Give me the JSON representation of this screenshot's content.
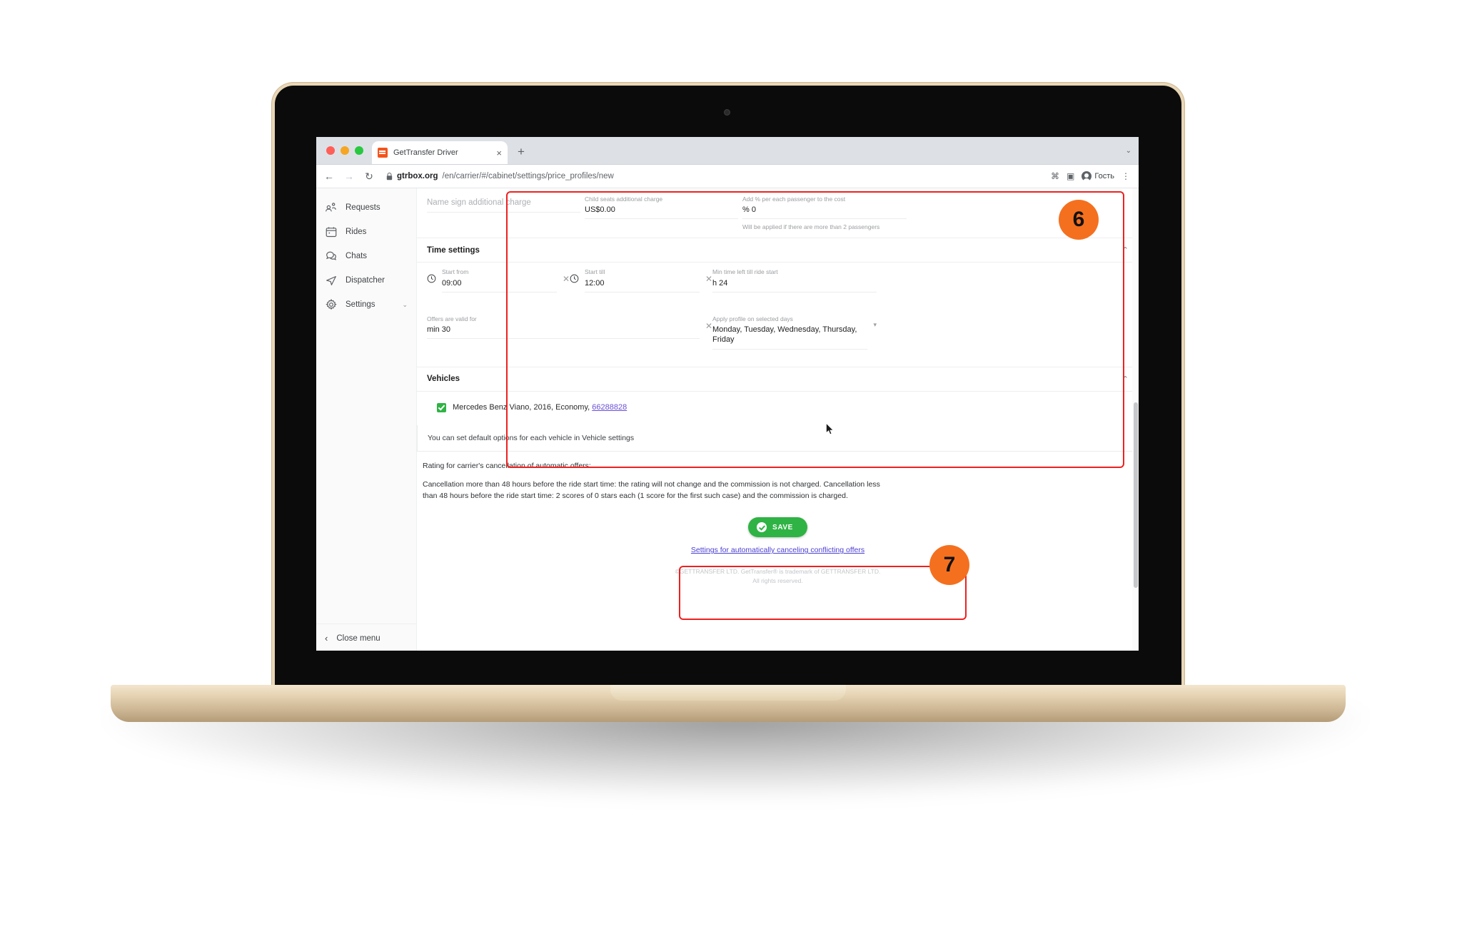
{
  "browser": {
    "tab_title": "GetTransfer Driver",
    "tab_close": "×",
    "new_tab": "+",
    "back": "←",
    "forward": "→",
    "reload": "↻",
    "lock": "🔒",
    "url_domain": "gtrbox.org",
    "url_path": "/en/carrier/#/cabinet/settings/price_profiles/new",
    "extensions_icon": "⌘",
    "sidepanel_icon": "▣",
    "profile_label": "Гость",
    "menu_icon": "⋮",
    "tabstrip_caret": "⌄"
  },
  "sidebar": {
    "items": [
      {
        "label": "Requests",
        "icon": "requests-icon",
        "caret": ""
      },
      {
        "label": "Rides",
        "icon": "calendar-icon",
        "caret": ""
      },
      {
        "label": "Chats",
        "icon": "chat-icon",
        "caret": ""
      },
      {
        "label": "Dispatcher",
        "icon": "send-icon",
        "caret": ""
      },
      {
        "label": "Settings",
        "icon": "gear-icon",
        "caret": "⌄"
      }
    ],
    "close_menu": "Close menu",
    "close_chevron": "‹"
  },
  "form": {
    "top_fields": [
      {
        "label": "",
        "placeholder": "Name sign additional charge",
        "value": "",
        "hint": ""
      },
      {
        "label": "Child seats additional charge",
        "placeholder": "",
        "value": "US$0.00",
        "hint": ""
      },
      {
        "label": "Add % per each passenger to the cost",
        "placeholder": "",
        "value": "% 0",
        "hint": "Will be applied if there are more than 2 passengers"
      }
    ],
    "time_settings": {
      "title": "Time settings",
      "collapse_chevron": "⌃",
      "fields_row1": [
        {
          "label": "Start from",
          "value": "09:00",
          "has_clock": true,
          "clear": "✕"
        },
        {
          "label": "Start till",
          "value": "12:00",
          "has_clock": true,
          "clear": "✕"
        },
        {
          "label": "Min time left till ride start",
          "value": "h 24",
          "has_clock": false,
          "clear": ""
        }
      ],
      "fields_row2": [
        {
          "label": "Offers are valid for",
          "value": "min 30",
          "clear": "✕",
          "caret": ""
        },
        {
          "label": "Apply profile on selected days",
          "value": "Monday, Tuesday, Wednesday, Thursday, Friday",
          "clear": "",
          "caret": "▾"
        }
      ]
    },
    "vehicles": {
      "title": "Vehicles",
      "collapse_chevron": "⌃",
      "checked": true,
      "vehicle_text": "Mercedes Benz Viano, 2016, Economy,",
      "vehicle_id": "66288828"
    },
    "note": "You can set default options for each vehicle in Vehicle settings"
  },
  "rating": {
    "title": "Rating for carrier's cancellation of automatic offers:",
    "body": "Cancellation more than 48 hours before the ride start time: the rating will not change and the commission is not charged. Cancellation less than 48 hours before the ride start time: 2 scores of 0 stars each (1 score for the first such case) and the commission is charged."
  },
  "actions": {
    "save_label": "SAVE",
    "cancel_link": "Settings for automatically canceling conflicting offers"
  },
  "footer": {
    "line1": "©GETTRANSFER LTD. GetTransfer® is trademark of GETTRANSFER LTD.",
    "line2": "All rights reserved."
  },
  "annotations": {
    "badge_6": "6",
    "badge_7": "7"
  },
  "colors": {
    "accent_orange": "#f4701f",
    "highlight_red": "#ef2020",
    "save_green": "#2fb344",
    "link_purple": "#4a3fd0"
  }
}
